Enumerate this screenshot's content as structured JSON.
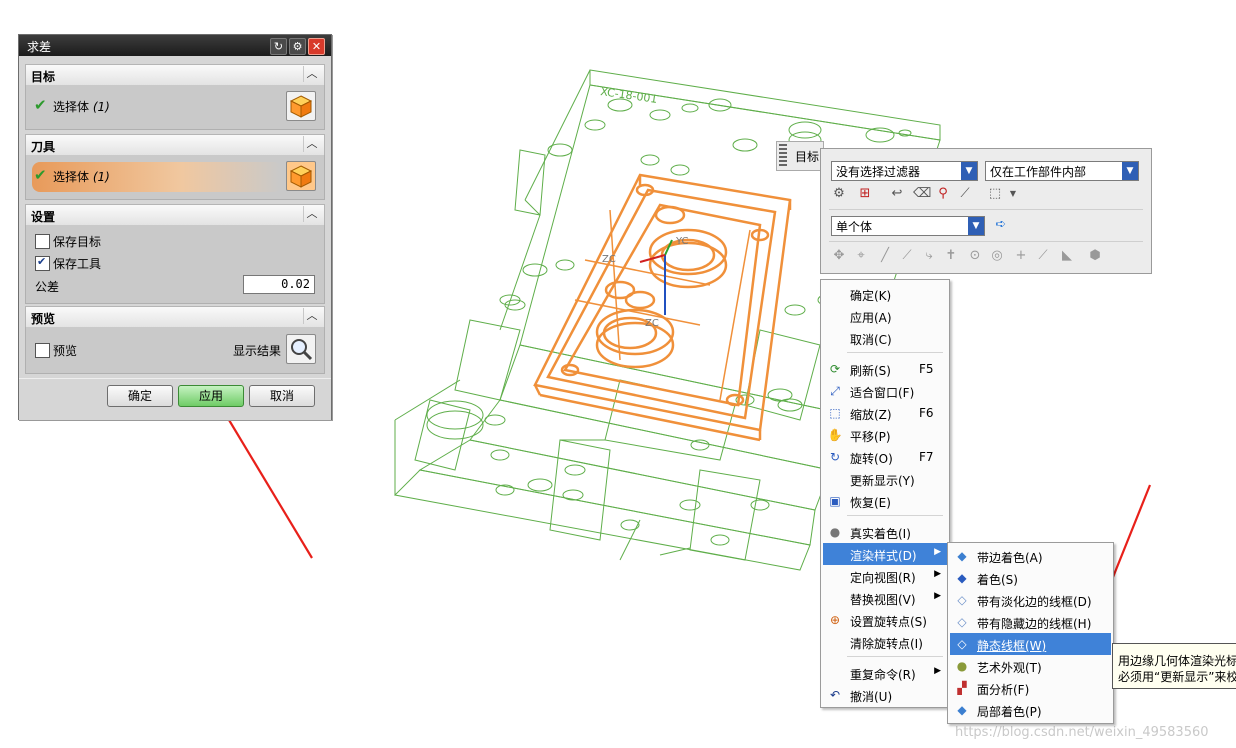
{
  "dialog": {
    "title": "求差",
    "title_buttons": [
      "reset-icon",
      "gear-icon",
      "close-icon"
    ],
    "sections": {
      "target": {
        "header": "目标",
        "select_label": "选择体",
        "select_count": "(1)"
      },
      "tool": {
        "header": "刀具",
        "select_label": "选择体",
        "select_count": "(1)"
      },
      "settings": {
        "header": "设置",
        "keep_target": "保存目标",
        "keep_tool": "保存工具",
        "tolerance_label": "公差",
        "tolerance_value": "0.02"
      },
      "preview": {
        "header": "预览",
        "preview_label": "预览",
        "show_result": "显示结果"
      }
    },
    "buttons": {
      "ok": "确定",
      "apply": "应用",
      "cancel": "取消"
    }
  },
  "viewport": {
    "target_tag": "目标",
    "model_text": "XC-18-001",
    "axis_labels": [
      "ZC",
      "YC",
      "ZC"
    ],
    "watermark": "https://blog.csdn.net/weixin_49583560"
  },
  "selbar": {
    "filter": "没有选择过滤器",
    "scope": "仅在工作部件内部",
    "type": "单个体"
  },
  "menu": {
    "items": [
      {
        "label": "确定(K)"
      },
      {
        "label": "应用(A)"
      },
      {
        "label": "取消(C)"
      },
      {
        "label": "刷新(S)",
        "shortcut": "F5"
      },
      {
        "label": "适合窗口(F)"
      },
      {
        "label": "缩放(Z)",
        "shortcut": "F6"
      },
      {
        "label": "平移(P)"
      },
      {
        "label": "旋转(O)",
        "shortcut": "F7"
      },
      {
        "label": "更新显示(Y)"
      },
      {
        "label": "恢复(E)"
      },
      {
        "label": "真实着色(I)"
      },
      {
        "label": "渲染样式(D)"
      },
      {
        "label": "定向视图(R)"
      },
      {
        "label": "替换视图(V)"
      },
      {
        "label": "设置旋转点(S)"
      },
      {
        "label": "清除旋转点(I)"
      },
      {
        "label": "重复命令(R)"
      },
      {
        "label": "撤消(U)"
      }
    ]
  },
  "submenu": {
    "items": [
      {
        "label": "带边着色(A)"
      },
      {
        "label": "着色(S)"
      },
      {
        "label": "带有淡化边的线框(D)"
      },
      {
        "label": "带有隐藏边的线框(H)"
      },
      {
        "label": "静态线框(W)"
      },
      {
        "label": "艺术外观(T)"
      },
      {
        "label": "面分析(F)"
      },
      {
        "label": "局部着色(P)"
      }
    ]
  },
  "tooltip": {
    "line1": "用边缘几何体渲染光标",
    "line2": "必须用“更新显示”来校正"
  },
  "colors": {
    "wire": "#5fae4a",
    "highlight": "#f0903a",
    "menu_highlight": "#3f82d8",
    "arrow": "#e8201a"
  }
}
